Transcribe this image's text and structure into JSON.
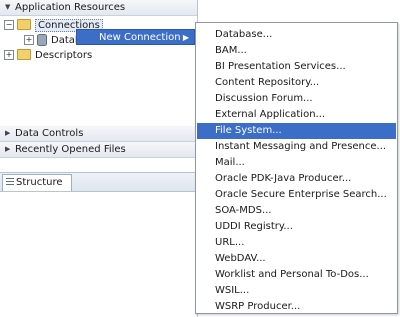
{
  "navigator": {
    "application_resources": "Application Resources",
    "tree": {
      "connections": "Connections",
      "databases": "Databases",
      "descriptors": "Descriptors"
    },
    "data_controls": "Data Controls",
    "recently_opened_files": "Recently Opened Files",
    "structure_tab": "Structure"
  },
  "context_menu": {
    "new_connection": "New Connection",
    "arrow_icon": "submenu-arrow-icon"
  },
  "submenu": {
    "highlighted_index": 8,
    "items": [
      {
        "label": "Database..."
      },
      {
        "label": "BAM..."
      },
      {
        "label": "BI Presentation Services..."
      },
      {
        "label": "Content Repository..."
      },
      {
        "label": "Discussion Forum..."
      },
      {
        "label": "External Application..."
      },
      {
        "label": "File System..."
      },
      {
        "label": "Instant Messaging and Presence..."
      },
      {
        "label": "Mail..."
      },
      {
        "label": "Oracle PDK-Java Producer..."
      },
      {
        "label": "Oracle Secure Enterprise Search..."
      },
      {
        "label": "SOA-MDS..."
      },
      {
        "label": "UDDI Registry..."
      },
      {
        "label": "URL..."
      },
      {
        "label": "WebDAV..."
      },
      {
        "label": "Worklist and Personal To-Dos..."
      },
      {
        "label": "WSIL..."
      },
      {
        "label": "WSRP Producer..."
      }
    ]
  },
  "colors": {
    "menu_highlight": "#3d6ec7",
    "folder": "#f2cf6a"
  }
}
